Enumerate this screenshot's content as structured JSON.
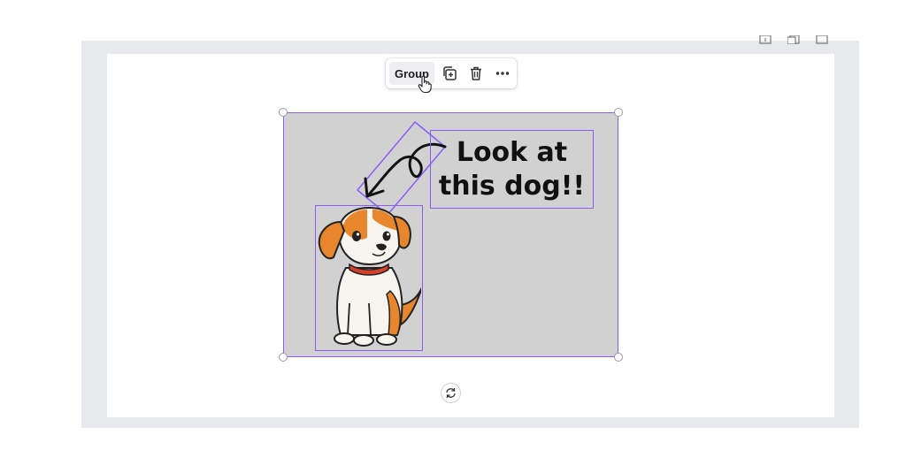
{
  "toolbar": {
    "group_label": "Group",
    "icons": [
      "duplicate-icon",
      "trash-icon",
      "more-icon"
    ]
  },
  "canvas": {
    "headline_line1": "Look at",
    "headline_line2": "this dog!!",
    "background_color": "#d1d1d1",
    "selection_color": "#8b5cf6"
  },
  "header_icons": [
    "info-icon",
    "add-page-icon",
    "expand-icon"
  ]
}
